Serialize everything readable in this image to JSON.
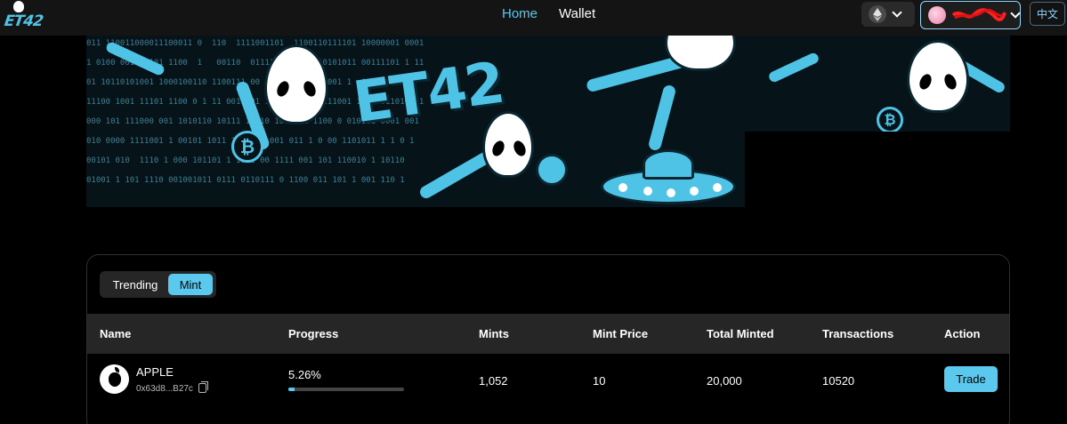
{
  "header": {
    "logo_text": "ET42",
    "nav": {
      "home": "Home",
      "wallet": "Wallet"
    },
    "chain_icon": "ethereum-icon",
    "account_avatar_icon": "avatar-icon",
    "lang": "中文",
    "colors": {
      "accent": "#5bc8ee",
      "topbar_bg": "#141414"
    }
  },
  "banner": {
    "title": "ET42",
    "coin_symbol": "₿",
    "binary_rows": [
      "011 110011000011100011 0  110  1111001101  1100110111101 10000001 0001",
      "1 0100 001111101 1100  1   00110  01111111 1 10110101011 00111101 1 11",
      "01 10110101001 1000100110 1100111 00 01 1 10110010001 1  011 1 10 01",
      "11100 1001 11101 1100 0 1 11 0011001 1001011 1 00111001 10 100110101 1",
      "000 101 111000 001 1010110 10111 10 10 1001011 1100 0 010111 0001 001",
      "010 0000 1111001 1 00101 1011 1101111 001 011 1 0 00 1101011 1 1 0 1",
      "00101 010  1110 1 000 101101 1 1011 00 1111 001 101 110010 1 10110",
      "01001 1 101 1110 001001011 0111 0110111 0 1100 011 101 1 001 110 1"
    ]
  },
  "panel": {
    "tabs": {
      "trending": "Trending",
      "mint": "Mint"
    },
    "columns": {
      "name": "Name",
      "progress": "Progress",
      "mints": "Mints",
      "mint_price": "Mint Price",
      "total_minted": "Total Minted",
      "transactions": "Transactions",
      "action": "Action"
    },
    "rows": [
      {
        "icon": "apple-icon",
        "name": "APPLE",
        "address": "0x63d8...B27c",
        "progress_text": "5.26%",
        "progress_value": 0.0526,
        "mints": "1,052",
        "mint_price": "10",
        "total_minted": "20,000",
        "transactions": "10520",
        "action": "Trade"
      }
    ]
  }
}
